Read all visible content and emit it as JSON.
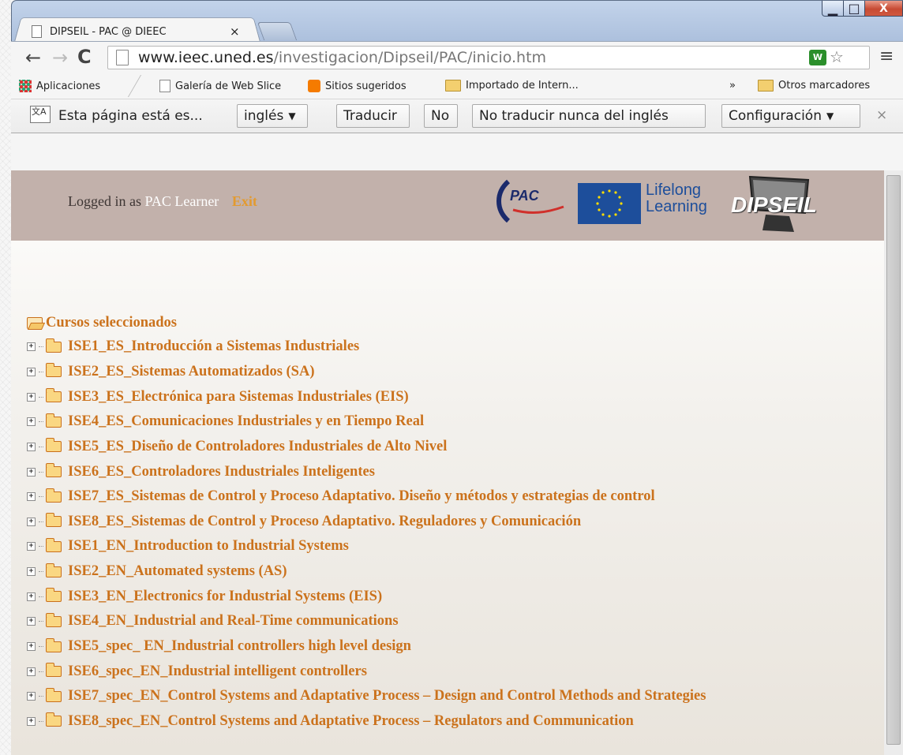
{
  "window": {
    "tab_title": "DIPSEIL - PAC @ DIEEC",
    "tab_close": "×",
    "min_glyph": "▁",
    "max_glyph": "□",
    "close_glyph": "X"
  },
  "nav": {
    "back": "←",
    "forward": "→",
    "reload": "C",
    "url_host": "www.ieec.uned.es",
    "url_path": "/investigacion/Dipseil/PAC/inicio.htm",
    "menu": "≡",
    "star": "☆",
    "extension_label": "W"
  },
  "bookmarks": {
    "apps": "Aplicaciones",
    "items": [
      "Galería de Web Slice",
      "Sitios sugeridos",
      "Importado de Intern..."
    ],
    "overflow": "»",
    "other": "Otros marcadores"
  },
  "translate_bar": {
    "icon_text": "文A",
    "message": "Esta página está es...",
    "language": "inglés",
    "translate": "Traducir",
    "no": "No",
    "never": "No traducir nunca del inglés",
    "settings": "Configuración",
    "close": "×"
  },
  "header": {
    "logged_prefix": "Logged in as",
    "user": "PAC Learner",
    "exit": "Exit",
    "pac_logo": "PAC",
    "lifelong_line1": "Lifelong",
    "lifelong_line2": "Learning",
    "dipseil_logo": "DIPSEIL"
  },
  "tree": {
    "root": "Cursos seleccionados",
    "expander": "+",
    "courses": [
      "ISE1_ES_Introducción a Sistemas Industriales",
      "ISE2_ES_Sistemas Automatizados (SA)",
      "ISE3_ES_Electrónica para Sistemas Industriales (EIS)",
      "ISE4_ES_Comunicaciones Industriales y en Tiempo Real",
      "ISE5_ES_Diseño de Controladores Industriales de Alto Nivel",
      "ISE6_ES_Controladores Industriales Inteligentes",
      "ISE7_ES_Sistemas de Control y Proceso Adaptativo. Diseño y métodos y estrategias de control",
      "ISE8_ES_Sistemas de Control y Proceso Adaptativo. Reguladores y Comunicación",
      "ISE1_EN_Introduction to Industrial Systems",
      "ISE2_EN_Automated systems (AS)",
      "ISE3_EN_Electronics for Industrial Systems (EIS)",
      "ISE4_EN_Industrial and Real-Time communications",
      "ISE5_spec_ EN_Industrial controllers high level design",
      "ISE6_spec_EN_Industrial intelligent controllers",
      "ISE7_spec_EN_Control Systems and Adaptative Process – Design and Control Methods and Strategies",
      "ISE8_spec_EN_Control Systems and Adaptative Process – Regulators and Communication"
    ]
  },
  "colors": {
    "link": "#cb721c",
    "header_bg": "#c2b1ab",
    "exit": "#e39a2f"
  }
}
